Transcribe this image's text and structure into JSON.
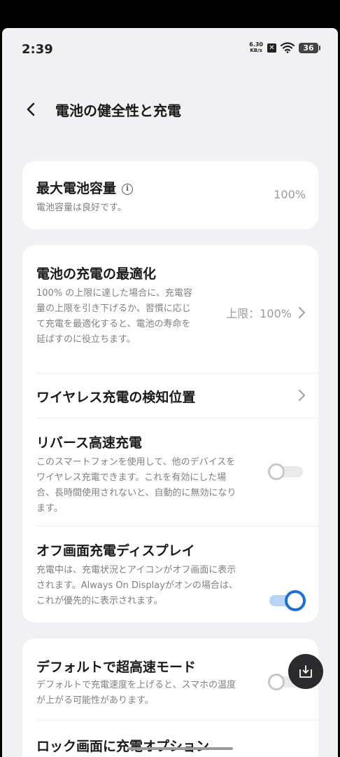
{
  "status_bar": {
    "time": "2:39",
    "net_speed_value": "6.30",
    "net_speed_unit": "KB/s",
    "battery": "36"
  },
  "header": {
    "title": "電池の健全性と充電"
  },
  "max_capacity": {
    "title": "最大電池容量",
    "desc": "電池容量は良好です。",
    "value": "100%"
  },
  "optimization": {
    "title": "電池の充電の最適化",
    "desc": "100% の上限に達した場合に、充電容量の上限を引き下げるか、習慣に応じて充電を最適化すると、電池の寿命を延ばすのに役立ちます。",
    "value": "上限：100%"
  },
  "wireless_position": {
    "title": "ワイヤレス充電の検知位置"
  },
  "reverse_charging": {
    "title": "リバース高速充電",
    "desc": "このスマートフォンを使用して、他のデバイスをワイヤレス充電できます。これを有効にした場合、長時間使用されないと、自動的に無効になります。",
    "enabled": false
  },
  "offscreen_display": {
    "title": "オフ画面充電ディスプレイ",
    "desc": "充電中は、充電状況とアイコンがオフ画面に表示されます。Always On Displayがオンの場合は、これが優先的に表示されます。",
    "enabled": true
  },
  "super_fast_default": {
    "title": "デフォルトで超高速モード",
    "desc": "デフォルトで充電速度を上げると、スマホの温度が上がる可能性があります。",
    "enabled": false
  },
  "lock_screen_options": {
    "title": "ロック画面に充電オプション"
  },
  "icons": {
    "back": "back-arrow-icon",
    "info": "info-icon",
    "chevron": "chevron-right-icon",
    "fab": "download-tray-icon"
  },
  "colors": {
    "accent": "#1f6ed4",
    "background": "#f1f1f3",
    "card": "#ffffff"
  }
}
